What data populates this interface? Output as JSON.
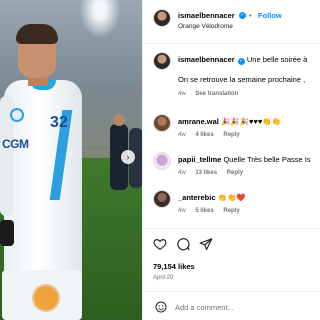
{
  "post": {
    "author": "ismaelbennacer",
    "location": "Orange Vélodrome",
    "follow_label": "Follow",
    "separator": "•",
    "verified_mark": "✓",
    "carousel_next": "›",
    "photo_text": {
      "sponsor": "CGM",
      "number": "32"
    }
  },
  "caption": {
    "username": "ismaelbennacer",
    "text_line1": "Une belle soirée à",
    "text_line2": "On se retrouve la semaine prochaine ,",
    "age": "4w",
    "see_translation": "See translation"
  },
  "comments": [
    {
      "username": "amrane.wal",
      "text": "🎉🎉🎉♥♥♥👏👏",
      "age": "4w",
      "likes": "4 likes",
      "reply": "Reply"
    },
    {
      "username": "papii_tellme",
      "text": "Quelle Très belle Passe Is",
      "age": "4w",
      "likes": "13 likes",
      "reply": "Reply"
    },
    {
      "username": "_anterebic",
      "text": "👏👏❤️",
      "age": "4w",
      "likes": "5 likes",
      "reply": "Reply"
    }
  ],
  "stats": {
    "likes": "79,154 likes",
    "date": "April 20"
  },
  "add_comment": {
    "placeholder": "Add a comment..."
  },
  "icons": [
    "heart-icon",
    "comment-icon",
    "share-icon",
    "emoji-icon",
    "chevron-right-icon",
    "verified-badge-icon"
  ],
  "colors": {
    "accent": "#0095f6",
    "muted": "#737373",
    "divider": "#efefef"
  }
}
